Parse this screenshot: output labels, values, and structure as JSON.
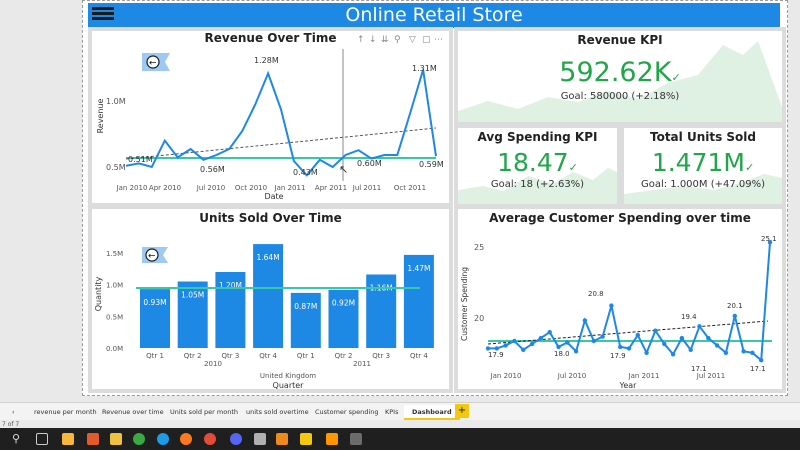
{
  "report": {
    "title": "Online Retail Store"
  },
  "revenue_chart": {
    "title": "Revenue Over Time",
    "xlabel": "Date",
    "ylabel": "Revenue",
    "yticks": [
      "1.0M",
      "0.5M"
    ],
    "xticks": [
      "Jan 2010",
      "Apr 2010",
      "Jul 2010",
      "Oct 2010",
      "Jan 2011",
      "Apr 2011",
      "Jul 2011",
      "Oct 2011"
    ],
    "labels": [
      "0.51M",
      "0.56M",
      "1.28M",
      "0.43M",
      "0.60M",
      "1.31M",
      "0.59M"
    ]
  },
  "revenue_kpi": {
    "title": "Revenue KPI",
    "value": "592.62K",
    "goal": "Goal: 580000 (+2.18%)"
  },
  "spending_kpi": {
    "title": "Avg Spending KPI",
    "value": "18.47",
    "goal": "Goal: 18 (+2.63%)"
  },
  "units_kpi": {
    "title": "Total Units Sold",
    "value": "1.471M",
    "goal": "Goal: 1.000M (+47.09%)"
  },
  "units_chart": {
    "title": "Units Sold Over Time",
    "xlabel": "Quarter",
    "ylabel": "Quantity",
    "country": "United Kingdom",
    "years": [
      "2010",
      "2011"
    ],
    "yticks": [
      "1.5M",
      "1.0M",
      "0.5M",
      "0.0M"
    ]
  },
  "spending_chart": {
    "title": "Average Customer Spending over time",
    "xlabel": "Year",
    "ylabel": "Customer Spending",
    "yticks": [
      "25",
      "20"
    ],
    "xticks": [
      "Jan 2010",
      "Jul 2010",
      "Jan 2011",
      "Jul 2011"
    ],
    "labels": [
      "17.9",
      "18.0",
      "20.8",
      "17.9",
      "19.4",
      "17.1",
      "20.1",
      "17.1",
      "25.1"
    ]
  },
  "chart_data": [
    {
      "type": "line",
      "title": "Revenue Over Time",
      "xlabel": "Date",
      "ylabel": "Revenue",
      "x": [
        "Dec 2009",
        "Jan 2010",
        "Feb 2010",
        "Mar 2010",
        "Apr 2010",
        "May 2010",
        "Jun 2010",
        "Jul 2010",
        "Aug 2010",
        "Sep 2010",
        "Oct 2010",
        "Nov 2010",
        "Dec 2010",
        "Jan 2011",
        "Feb 2011",
        "Mar 2011",
        "Apr 2011",
        "May 2011",
        "Jun 2011",
        "Jul 2011",
        "Aug 2011",
        "Sep 2011",
        "Oct 2011",
        "Nov 2011",
        "Dec 2011"
      ],
      "values": [
        0.51,
        0.53,
        0.5,
        0.72,
        0.58,
        0.65,
        0.56,
        0.6,
        0.65,
        0.8,
        1.02,
        1.28,
        0.98,
        0.55,
        0.43,
        0.56,
        0.5,
        0.6,
        0.64,
        0.57,
        0.6,
        0.6,
        0.95,
        1.31,
        0.59
      ],
      "ylim": [
        0.4,
        1.4
      ]
    },
    {
      "type": "bar",
      "title": "Units Sold Over Time",
      "xlabel": "Quarter",
      "ylabel": "Quantity",
      "categories": [
        "Qtr 1",
        "Qtr 2",
        "Qtr 3",
        "Qtr 4",
        "Qtr 1",
        "Qtr 2",
        "Qtr 3",
        "Qtr 4"
      ],
      "years": [
        "2010",
        "2010",
        "2010",
        "2010",
        "2011",
        "2011",
        "2011",
        "2011"
      ],
      "value_labels": [
        "0.93M",
        "1.05M",
        "1.20M",
        "1.64M",
        "0.87M",
        "0.92M",
        "1.16M",
        "1.47M"
      ],
      "values": [
        0.93,
        1.05,
        1.2,
        1.64,
        0.87,
        0.92,
        1.16,
        1.47
      ],
      "ylim": [
        0,
        1.8
      ]
    },
    {
      "type": "line",
      "title": "Average Customer Spending over time",
      "xlabel": "Year",
      "ylabel": "Customer Spending",
      "values": [
        17.9,
        17.9,
        18.1,
        18.4,
        17.8,
        18.2,
        18.6,
        19.0,
        18.0,
        18.3,
        17.7,
        19.8,
        18.4,
        18.7,
        20.8,
        18.0,
        17.9,
        18.8,
        17.6,
        19.1,
        18.2,
        17.5,
        18.6,
        17.8,
        19.4,
        18.6,
        18.1,
        17.6,
        20.1,
        17.7,
        17.6,
        17.1,
        25.1
      ],
      "ylim": [
        16.5,
        26
      ]
    }
  ],
  "tabs": [
    {
      "label": "revenue per month"
    },
    {
      "label": "Revenue over time"
    },
    {
      "label": "Units sold per month"
    },
    {
      "label": "units sold overtime"
    },
    {
      "label": "Customer spending"
    },
    {
      "label": "KPIs"
    },
    {
      "label": "Dashboard"
    }
  ],
  "add_tab": "+",
  "page_count": "7 of 7",
  "colors": {
    "accent": "#1e88e5",
    "kpi_green": "#22a64a",
    "target": "#35c9a8"
  }
}
